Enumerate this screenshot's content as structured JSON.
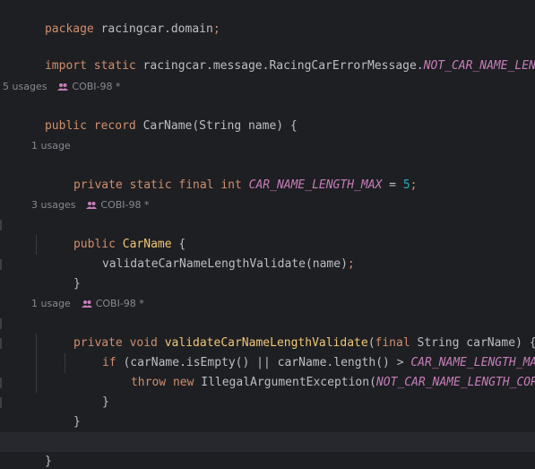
{
  "editor": {
    "line_package": {
      "kw": "package",
      "rest": " racingcar.domain",
      "semi": ";"
    },
    "line_import": {
      "kw1": "import",
      "kw2": "static",
      "path": " racingcar.message.RacingCarErrorMessage.",
      "const": "NOT_CAR_NAME_LENGTH_C"
    },
    "hint_record": {
      "usages": "5 usages",
      "author": "COBI-98 *"
    },
    "line_record": {
      "kw1": "public",
      "kw2": "record",
      "name": "CarName",
      "params": "(String name) {"
    },
    "hint_field": {
      "usages": "1 usage"
    },
    "line_field": {
      "kw": "private static final int",
      "const": "CAR_NAME_LENGTH_MAX",
      "eq": " = ",
      "num": "5",
      "semi": ";"
    },
    "hint_ctor": {
      "usages": "3 usages",
      "author": "COBI-98 *"
    },
    "line_ctor": {
      "kw": "public",
      "name": "CarName",
      "brace": " {"
    },
    "line_ctor_call": {
      "call": "validateCarNameLengthValidate",
      "args": "(name)",
      "semi": ";"
    },
    "line_ctor_close": {
      "text": "}"
    },
    "hint_method": {
      "usages": "1 usage",
      "author": "COBI-98 *"
    },
    "line_method": {
      "kw1": "private void",
      "name": "validateCarNameLengthValidate",
      "open": "(",
      "kw2": "final",
      "params": " String carName) {"
    },
    "line_if": {
      "kw": "if",
      "cond": " (carName.isEmpty() || carName.length() > ",
      "const": "CAR_NAME_LENGTH_MAX",
      "close": ") {"
    },
    "line_throw": {
      "kw1": "throw",
      "kw2": "new",
      "cls": " IllegalArgumentException(",
      "const": "NOT_CAR_NAME_LENGTH_CORRECT"
    },
    "line_if_close": {
      "text": "}"
    },
    "line_method_close": {
      "text": "}"
    },
    "line_record_close": {
      "text": "}"
    }
  },
  "colors": {
    "background": "#1e1f22",
    "keyword": "#cf8e6d",
    "constant": "#c77dbb",
    "number": "#2aacb8",
    "function": "#56a8f5",
    "text": "#bcbec4",
    "hint": "#868a91"
  },
  "icons": {
    "author": "users-icon"
  }
}
